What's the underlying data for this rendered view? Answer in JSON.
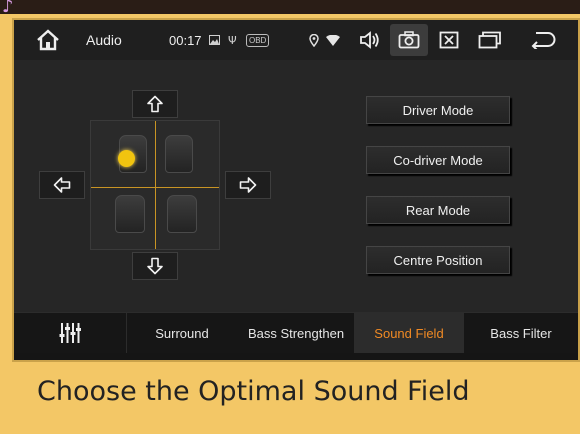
{
  "statusbar": {
    "app_title": "Audio",
    "time": "00:17",
    "status_icons": [
      "image-icon",
      "usb-icon",
      "obd-badge-icon"
    ],
    "obd_label": "OBD",
    "right_icons": [
      "location-icon",
      "wifi-icon",
      "volume-icon",
      "camera-icon",
      "close-window-icon",
      "multi-window-icon",
      "back-icon"
    ]
  },
  "sound_field": {
    "buttons": [
      {
        "label": "Driver Mode"
      },
      {
        "label": "Co-driver Mode"
      },
      {
        "label": "Rear Mode"
      },
      {
        "label": "Centre Position"
      }
    ]
  },
  "tabs": [
    {
      "label": "Surround",
      "active": false
    },
    {
      "label": "Bass Strengthen",
      "active": false
    },
    {
      "label": "Sound Field",
      "active": true
    },
    {
      "label": "Bass Filter",
      "active": false
    }
  ],
  "headline": "Choose the Optimal Sound Field",
  "colors": {
    "background": "#f3c766",
    "accent": "#f08a24",
    "focus_dot": "#f1c40f",
    "crosshair": "#c89424"
  }
}
